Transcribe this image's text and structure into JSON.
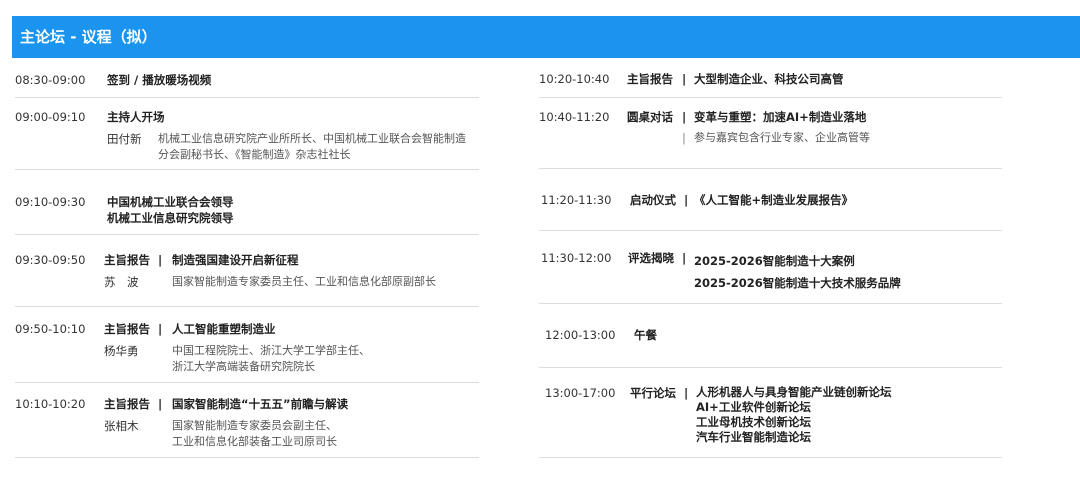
{
  "header": {
    "title": "主论坛 - 议程（拟）"
  },
  "left": {
    "s1": {
      "time": "08:30-09:00",
      "title": "签到 / 播放暖场视频"
    },
    "s2": {
      "time": "09:00-09:10",
      "title": "主持人开场",
      "speaker": "田付新",
      "desc": [
        "机械工业信息研究院产业所所长、中国机械工业联合会智能制造",
        "分会副秘书长、《智能制造》杂志社社长"
      ]
    },
    "s3": {
      "time": "09:10-09:30",
      "lines": [
        "中国机械工业联合会领导",
        "机械工业信息研究院领导"
      ]
    },
    "s4": {
      "time": "09:30-09:50",
      "label": "主旨报告",
      "sep": "|",
      "title": "制造强国建设开启新征程",
      "speaker": "苏　波",
      "desc": [
        "国家智能制造专家委员主任、工业和信息化部原副部长"
      ]
    },
    "s5": {
      "time": "09:50-10:10",
      "label": "主旨报告",
      "sep": "|",
      "title": "人工智能重塑制造业",
      "speaker": "杨华勇",
      "desc": [
        "中国工程院院士、浙江大学工学部主任、",
        "浙江大学高端装备研究院院长"
      ]
    },
    "s6": {
      "time": "10:10-10:20",
      "label": "主旨报告",
      "sep": "|",
      "title": "国家智能制造“十五五”前瞻与解读",
      "speaker": "张相木",
      "desc": [
        "国家智能制造专家委员会副主任、",
        "工业和信息化部装备工业司原司长"
      ]
    }
  },
  "right": {
    "s1": {
      "time": "10:20-10:40",
      "label": "主旨报告",
      "sep": "|",
      "title": "大型制造企业、科技公司高管"
    },
    "s2": {
      "time": "10:40-11:20",
      "label": "圆桌对话",
      "sep": "|",
      "title": "变革与重塑：加速AI+制造业落地",
      "sep2": "|",
      "note": "参与嘉宾包含行业专家、企业高管等"
    },
    "s3": {
      "time": "11:20-11:30",
      "label": "启动仪式",
      "sep": "|",
      "title": "《人工智能+制造业发展报告》"
    },
    "s4": {
      "time": "11:30-12:00",
      "label": "评选揭晓",
      "sep": "|",
      "lines": [
        "2025-2026智能制造十大案例",
        "2025-2026智能制造十大技术服务品牌"
      ]
    },
    "s5": {
      "time": "12:00-13:00",
      "title": "午餐"
    },
    "s6": {
      "time": "13:00-17:00",
      "label": "平行论坛",
      "sep": "|",
      "lines": [
        "人形机器人与具身智能产业链创新论坛",
        "AI+工业软件创新论坛",
        "工业母机技术创新论坛",
        "汽车行业智能制造论坛"
      ]
    }
  }
}
